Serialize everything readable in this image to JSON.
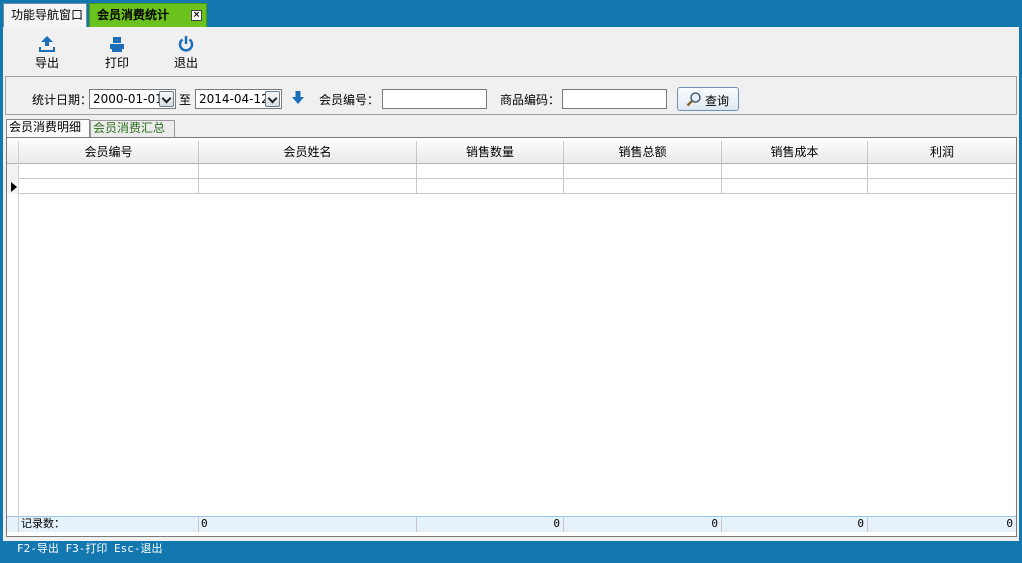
{
  "window_tabs": [
    {
      "label": "功能导航窗口"
    },
    {
      "label": "会员消费统计",
      "close": "×"
    }
  ],
  "toolbar": {
    "export_label": "导出",
    "print_label": "打印",
    "exit_label": "退出"
  },
  "filter": {
    "date_label": "统计日期：",
    "start_date": "2000-01-01",
    "to_label": "至",
    "end_date": "2014-04-12",
    "member_label": "会员编号：",
    "member_value": "",
    "product_label": "商品编码：",
    "product_value": "",
    "query_label": "查询"
  },
  "sub_tabs": [
    {
      "label": "会员消费明细"
    },
    {
      "label": "会员消费汇总"
    }
  ],
  "table": {
    "columns": [
      "会员编号",
      "会员姓名",
      "销售数量",
      "销售总额",
      "销售成本",
      "利润"
    ],
    "footer": {
      "label": "记录数：",
      "values": [
        "0",
        "",
        "0",
        "0",
        "0",
        "0"
      ]
    }
  },
  "status_bar": "F2-导出 F3-打印 Esc-退出",
  "colors": {
    "frame": "#1377b0",
    "active_tab": "#6cc21c",
    "footer_row": "#e5f2fc"
  },
  "icons": [
    "export-icon",
    "print-icon",
    "power-icon",
    "arrow-down-icon",
    "magnifier-icon",
    "dropdown-arrow-icon",
    "close-icon",
    "row-pointer-icon"
  ]
}
